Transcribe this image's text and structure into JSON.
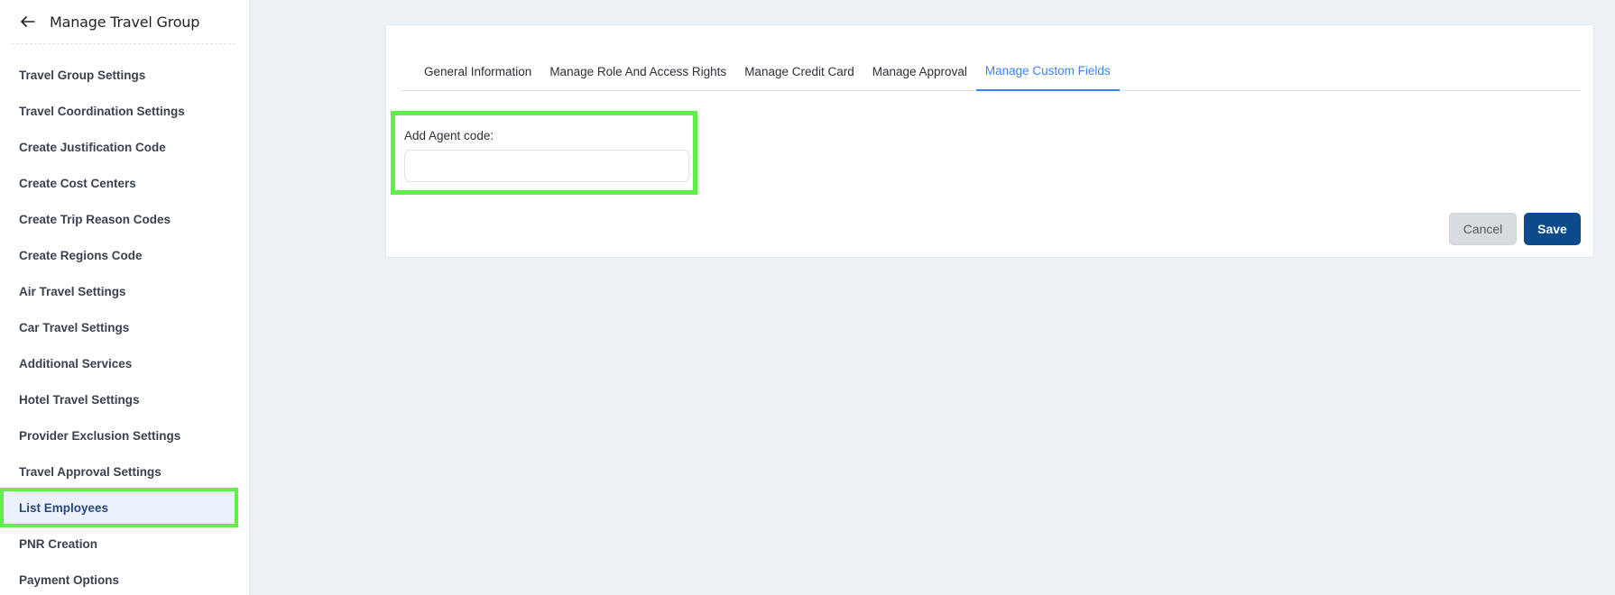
{
  "sidebar": {
    "title": "Manage Travel Group",
    "back_icon": "arrow-left-icon",
    "items": [
      {
        "label": "Travel Group Settings"
      },
      {
        "label": "Travel Coordination Settings"
      },
      {
        "label": "Create Justification Code"
      },
      {
        "label": "Create Cost Centers"
      },
      {
        "label": "Create Trip Reason Codes"
      },
      {
        "label": "Create Regions Code"
      },
      {
        "label": "Air Travel Settings"
      },
      {
        "label": "Car Travel Settings"
      },
      {
        "label": "Additional Services"
      },
      {
        "label": "Hotel Travel Settings"
      },
      {
        "label": "Provider Exclusion Settings"
      },
      {
        "label": "Travel Approval Settings"
      },
      {
        "label": "List Employees",
        "active": true
      },
      {
        "label": "PNR Creation"
      },
      {
        "label": "Payment Options"
      }
    ]
  },
  "tabs": [
    {
      "label": "General Information"
    },
    {
      "label": "Manage Role And Access Rights"
    },
    {
      "label": "Manage Credit Card"
    },
    {
      "label": "Manage Approval"
    },
    {
      "label": "Manage Custom Fields",
      "active": true
    }
  ],
  "form": {
    "agent_code_label": "Add Agent code:",
    "agent_code_value": ""
  },
  "actions": {
    "cancel_label": "Cancel",
    "save_label": "Save"
  },
  "colors": {
    "accent": "#3b82f6",
    "primary_button": "#0d4a8c",
    "highlight": "#5ef048"
  }
}
